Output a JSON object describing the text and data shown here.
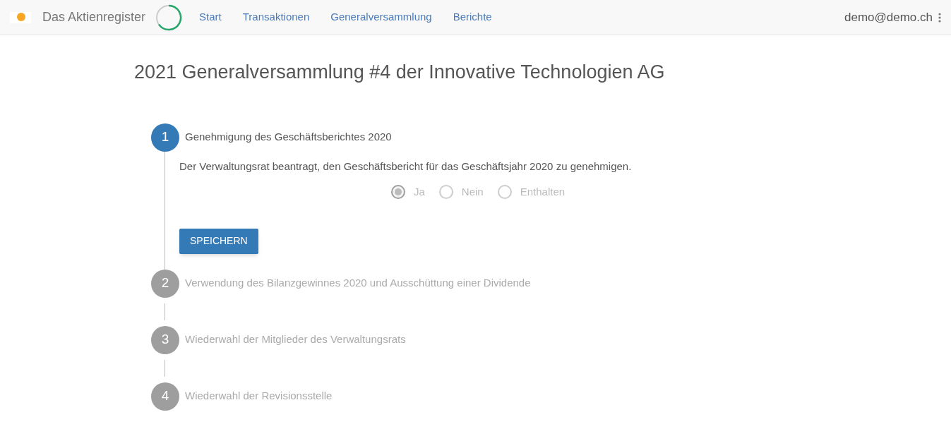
{
  "navbar": {
    "brand": "Das Aktienregister",
    "links": [
      {
        "label": "Start"
      },
      {
        "label": "Transaktionen"
      },
      {
        "label": "Generalversammlung"
      },
      {
        "label": "Berichte"
      }
    ],
    "user": "demo@demo.ch"
  },
  "title": "2021 Generalversammlung #4 der Innovative Technologien AG",
  "steps": [
    {
      "number": "1",
      "label": "Genehmigung des Geschäftsberichtes 2020",
      "active": true,
      "description": "Der Verwaltungsrat beantragt, den Geschäftsbericht für das Geschäftsjahr 2020 zu genehmigen.",
      "options": [
        {
          "label": "Ja",
          "selected": true
        },
        {
          "label": "Nein",
          "selected": false
        },
        {
          "label": "Enthalten",
          "selected": false
        }
      ],
      "button": "SPEICHERN"
    },
    {
      "number": "2",
      "label": "Verwendung des Bilanzgewinnes 2020 und Ausschüttung einer Dividende",
      "active": false
    },
    {
      "number": "3",
      "label": "Wiederwahl der Mitglieder des Verwaltungsrats",
      "active": false
    },
    {
      "number": "4",
      "label": "Wiederwahl der Revisionsstelle",
      "active": false
    }
  ]
}
